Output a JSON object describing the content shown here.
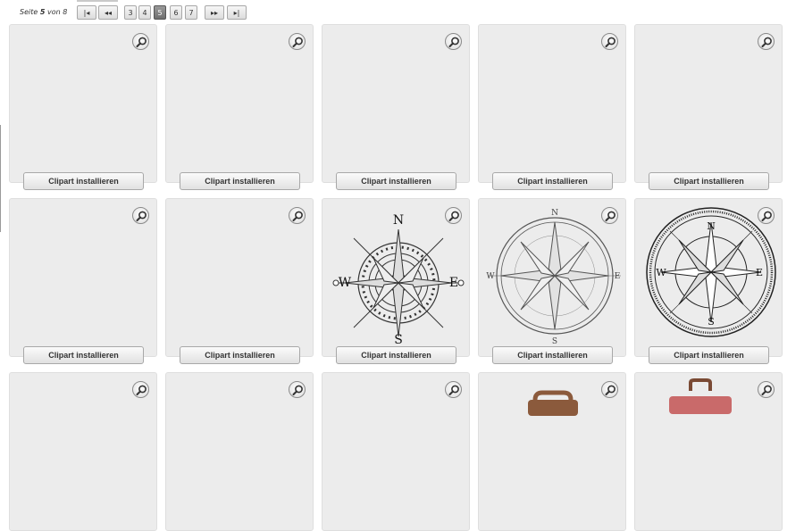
{
  "pagination": {
    "label_prefix": "Seite",
    "current": "5",
    "label_middle": "von",
    "total": "8",
    "first": "|◂",
    "prev": "◂◂",
    "pages": [
      "3",
      "4",
      "5",
      "6",
      "7"
    ],
    "next": "▸▸",
    "last": "▸|"
  },
  "tiles": {
    "install_label": "Clipart installieren",
    "count": 15
  },
  "compass": {
    "north": "N",
    "south": "S",
    "east": "E",
    "west": "W"
  },
  "colors": {
    "tile_bg": "#ececec",
    "active_page": "#777777",
    "suitcase_brown": "#8b5a3c",
    "suitcase_red": "#c96a6a"
  }
}
